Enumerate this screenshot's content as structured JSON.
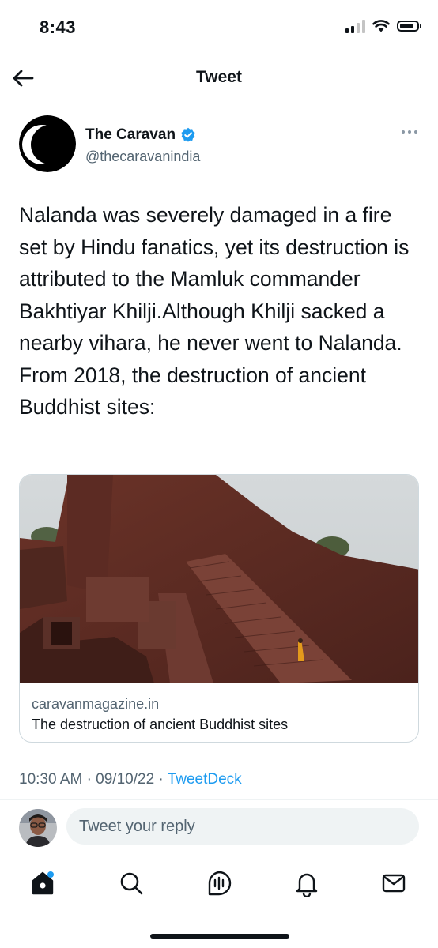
{
  "status_bar": {
    "time": "8:43",
    "battery_level": 0.85
  },
  "header": {
    "title": "Tweet"
  },
  "author": {
    "name": "The Caravan",
    "handle": "@thecaravanindia",
    "verified": true
  },
  "tweet": {
    "text": "Nalanda was severely damaged in a fire set by Hindu fanatics, yet its destruction is attributed to the Mamluk commander Bakhtiyar Khilji.Although Khilji sacked a nearby vihara, he never went to Nalanda. From 2018, the destruction of ancient Buddhist sites:"
  },
  "card": {
    "domain": "caravanmagazine.in",
    "title": "The destruction of ancient Buddhist sites"
  },
  "meta": {
    "time": "10:30 AM",
    "separator": "·",
    "date": "09/10/22",
    "source": "TweetDeck"
  },
  "reply": {
    "placeholder": "Tweet your reply"
  },
  "tabbar": {
    "items": [
      {
        "icon": "home-icon",
        "notification_dot": true
      },
      {
        "icon": "search-icon"
      },
      {
        "icon": "spaces-icon"
      },
      {
        "icon": "notifications-icon"
      },
      {
        "icon": "messages-icon"
      }
    ]
  },
  "colors": {
    "accent": "#1d9bf0",
    "text_primary": "#0f1419",
    "text_secondary": "#536471",
    "border": "#cfd9de"
  }
}
